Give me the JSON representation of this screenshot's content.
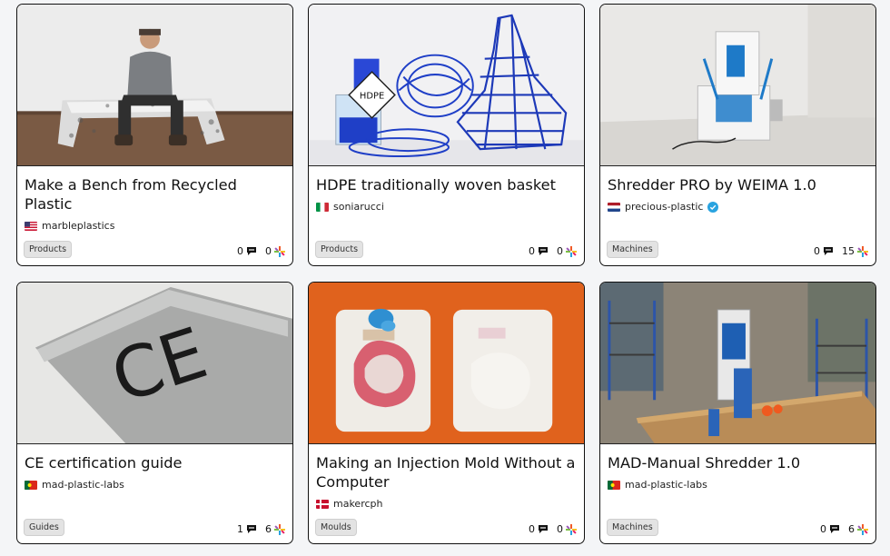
{
  "cards": [
    {
      "title": "Make a Bench from Recycled Plastic",
      "author": "marbleplastics",
      "flag": "us",
      "tag": "Products",
      "comments": "0",
      "useful": "0",
      "verified": false
    },
    {
      "title": "HDPE traditionally woven basket",
      "author": "soniarucci",
      "flag": "it",
      "tag": "Products",
      "comments": "0",
      "useful": "0",
      "verified": false
    },
    {
      "title": "Shredder PRO by WEIMA 1.0",
      "author": "precious-plastic",
      "flag": "nl",
      "tag": "Machines",
      "comments": "0",
      "useful": "15",
      "verified": true
    },
    {
      "title": "CE certification guide",
      "author": "mad-plastic-labs",
      "flag": "pt",
      "tag": "Guides",
      "comments": "1",
      "useful": "6",
      "verified": false
    },
    {
      "title": "Making an Injection Mold Without a Computer",
      "author": "makercph",
      "flag": "dk",
      "tag": "Moulds",
      "comments": "0",
      "useful": "0",
      "verified": false
    },
    {
      "title": "MAD-Manual Shredder 1.0",
      "author": "mad-plastic-labs",
      "flag": "pt",
      "tag": "Machines",
      "comments": "0",
      "useful": "6",
      "verified": false
    }
  ],
  "images": {
    "card0": {
      "sign": ""
    },
    "card1": {
      "sign": "HDPE"
    },
    "card3": {
      "sign": "CE"
    }
  },
  "icons": {
    "comment": "comment-bubble-icon",
    "useful": "star-burst-icon",
    "verified": "verified-badge-icon"
  },
  "colors": {
    "card_border": "#111111",
    "tag_bg": "#e3e3e3",
    "verified": "#29a3e0"
  }
}
